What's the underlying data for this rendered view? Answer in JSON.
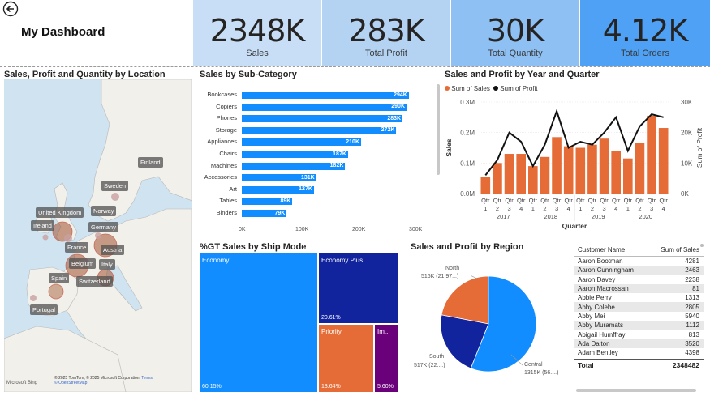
{
  "header": {
    "title": "My Dashboard",
    "back_icon": "back-arrow-icon",
    "kpis": [
      {
        "value": "2348K",
        "label": "Sales",
        "color": "#c7def6"
      },
      {
        "value": "283K",
        "label": "Total Profit",
        "color": "#b4d3f3"
      },
      {
        "value": "30K",
        "label": "Total Quantity",
        "color": "#8ec0f3"
      },
      {
        "value": "4.12K",
        "label": "Total Orders",
        "color": "#4ea1f5"
      }
    ]
  },
  "map": {
    "title": "Sales, Profit and Quantity by Location",
    "labels": [
      "Finland",
      "Sweden",
      "Norway",
      "United Kingdom",
      "Ireland",
      "Germany",
      "France",
      "Austria",
      "Belgium",
      "Italy",
      "Switzerland",
      "Spain",
      "Portugal"
    ],
    "attribution": "© 2025 TomTom, © 2025 Microsoft Corporation,",
    "attribution_link": "Terms",
    "attribution2": "© OpenStreetMap",
    "logo": "Microsoft Bing"
  },
  "subcategory": {
    "title": "Sales by Sub-Category",
    "ticks": [
      "0K",
      "100K",
      "200K",
      "300K"
    ]
  },
  "yearquarter": {
    "title": "Sales and Profit by Year and Quarter",
    "legend_sales": "Sum of Sales",
    "legend_profit": "Sum of Profit",
    "ylabel_left": "Sales",
    "ylabel_right": "Sum of Profit",
    "xlabel": "Quarter",
    "left_ticks": [
      "0.3M",
      "0.2M",
      "0.1M",
      "0.0M"
    ],
    "right_ticks": [
      "30K",
      "20K",
      "10K",
      "0K"
    ],
    "q_label": "Qtr",
    "years": [
      "2017",
      "2018",
      "2019",
      "2020"
    ]
  },
  "shipmode": {
    "title": "%GT Sales by Ship Mode",
    "blocks": [
      {
        "label": "Economy",
        "pct": "60.15%"
      },
      {
        "label": "Economy Plus",
        "pct": "20.61%"
      },
      {
        "label": "Priority",
        "pct": "13.64%"
      },
      {
        "label": "Im...",
        "pct": "5.60%"
      }
    ]
  },
  "region": {
    "title": "Sales and Profit by Region",
    "north_label": "North",
    "north_value": "516K (21.97...)",
    "south_label": "South",
    "south_value": "517K (22....)",
    "central_label": "Central",
    "central_value": "1315K (56....)"
  },
  "table": {
    "col1": "Customer Name",
    "col2": "Sum of Sales",
    "rows": [
      {
        "name": "Aaron Bootman",
        "sales": "4281"
      },
      {
        "name": "Aaron Cunningham",
        "sales": "2463"
      },
      {
        "name": "Aaron Davey",
        "sales": "2238"
      },
      {
        "name": "Aaron Macrossan",
        "sales": "81"
      },
      {
        "name": "Abbie Perry",
        "sales": "1313"
      },
      {
        "name": "Abby Colebe",
        "sales": "2805"
      },
      {
        "name": "Abby Mei",
        "sales": "5940"
      },
      {
        "name": "Abby Muramats",
        "sales": "1112"
      },
      {
        "name": "Abigail Humffray",
        "sales": "813"
      },
      {
        "name": "Ada Dalton",
        "sales": "3520"
      },
      {
        "name": "Adam Bentley",
        "sales": "4398"
      }
    ],
    "total_label": "Total",
    "total_value": "2348482"
  },
  "chart_data": [
    {
      "type": "bar",
      "title": "Sales by Sub-Category",
      "categories": [
        "Bookcases",
        "Copiers",
        "Phones",
        "Storage",
        "Appliances",
        "Chairs",
        "Machines",
        "Accessories",
        "Art",
        "Tables",
        "Binders"
      ],
      "values": [
        294,
        290,
        283,
        272,
        210,
        187,
        182,
        131,
        127,
        89,
        79
      ],
      "value_labels": [
        "294K",
        "290K",
        "283K",
        "272K",
        "210K",
        "187K",
        "182K",
        "131K",
        "127K",
        "89K",
        "79K"
      ],
      "unit": "K",
      "xlim": [
        0,
        300
      ],
      "color": "#118dff"
    },
    {
      "type": "bar",
      "title": "Sales and Profit by Year and Quarter",
      "categories": [
        "2017 Q1",
        "2017 Q2",
        "2017 Q3",
        "2017 Q4",
        "2018 Q1",
        "2018 Q2",
        "2018 Q3",
        "2018 Q4",
        "2019 Q1",
        "2019 Q2",
        "2019 Q3",
        "2019 Q4",
        "2020 Q1",
        "2020 Q2",
        "2020 Q3",
        "2020 Q4"
      ],
      "series": [
        {
          "name": "Sum of Sales",
          "type": "bar",
          "axis": "left",
          "color": "#e66c37",
          "values": [
            0.055,
            0.1,
            0.13,
            0.13,
            0.09,
            0.12,
            0.185,
            0.155,
            0.15,
            0.16,
            0.18,
            0.14,
            0.115,
            0.165,
            0.255,
            0.215
          ]
        },
        {
          "name": "Sum of Profit",
          "type": "line",
          "axis": "right",
          "color": "#111111",
          "values": [
            6,
            11,
            20,
            17,
            9,
            16,
            27,
            15,
            17,
            16,
            20,
            25,
            14,
            22,
            26,
            25
          ]
        }
      ],
      "ylim_left": [
        0,
        0.3
      ],
      "ylim_right": [
        0,
        30
      ]
    },
    {
      "type": "pie",
      "title": "Sales and Profit by Region",
      "categories": [
        "North",
        "South",
        "Central"
      ],
      "values": [
        516,
        517,
        1315
      ],
      "colors": [
        "#e66c37",
        "#12239e",
        "#118dff"
      ]
    },
    {
      "type": "heatmap",
      "title": "%GT Sales by Ship Mode",
      "categories": [
        "Economy",
        "Economy Plus",
        "Priority",
        "Im..."
      ],
      "values": [
        60.15,
        20.61,
        13.64,
        5.6
      ],
      "colors": [
        "#118dff",
        "#12239e",
        "#e66c37",
        "#6b007b"
      ]
    }
  ]
}
